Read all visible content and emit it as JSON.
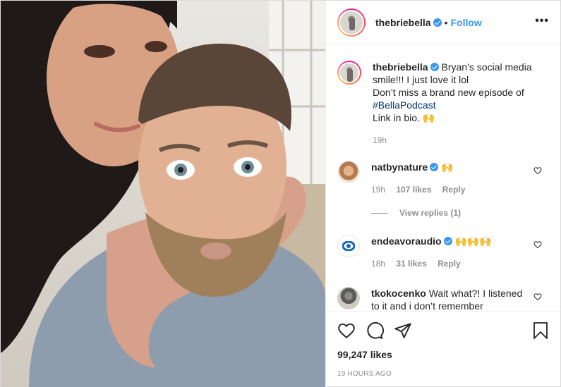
{
  "author": {
    "username": "thebriebella",
    "follow_label": "Follow",
    "more_label": "•••"
  },
  "caption": {
    "username": "thebriebella",
    "line1": "Bryan’s social media smile!!! I just love it lol",
    "line2": "Don’t miss a brand new episode of",
    "hashtag": "#BellaPodcast",
    "line3": "Link in bio. 🙌",
    "time": "19h"
  },
  "comments": [
    {
      "username": "natbynature",
      "text": "🙌",
      "time": "19h",
      "likes": "107 likes",
      "reply": "Reply",
      "view_replies": "View replies (1)"
    },
    {
      "username": "endeavoraudio",
      "text": "🙌🙌🙌",
      "time": "18h",
      "likes": "31 likes",
      "reply": "Reply"
    },
    {
      "username": "tkokocenko",
      "text": "Wait what?! I listened to it and i don’t remember"
    }
  ],
  "stats": {
    "likes": "99,247 likes",
    "posted": "19 HOURS AGO"
  },
  "colors": {
    "accent": "#3897f0",
    "muted": "#8e8e8e",
    "hashtag": "#00376b"
  },
  "icons": [
    "heart-icon",
    "comment-icon",
    "share-icon",
    "save-icon",
    "verified-icon",
    "more-icon"
  ]
}
